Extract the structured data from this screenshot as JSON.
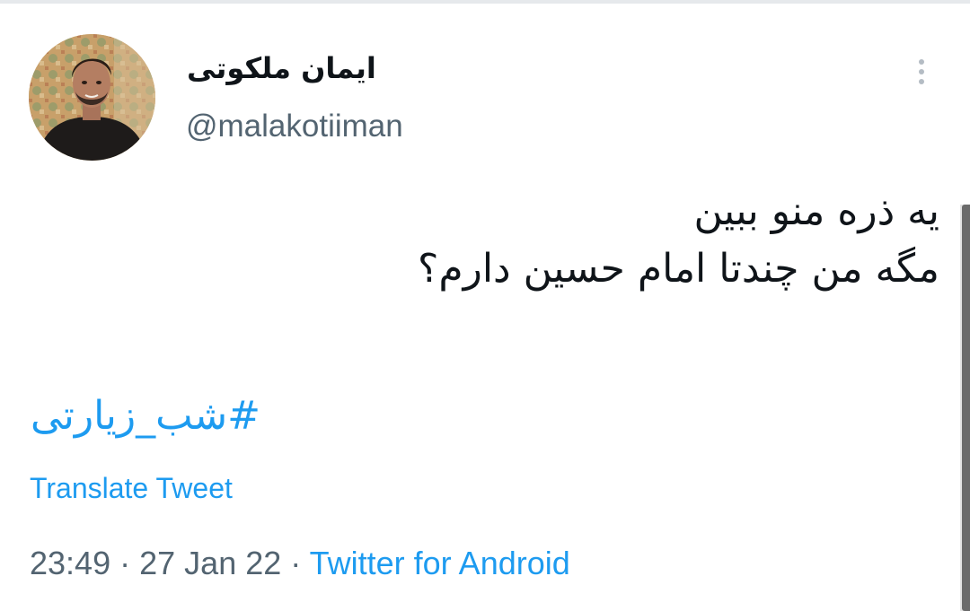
{
  "author": {
    "display_name": "ایمان ملکوتی",
    "handle": "@malakotiiman"
  },
  "tweet": {
    "lines": [
      "یه ذره منو ببین",
      "مگه من چندتا امام حسین دارم؟"
    ],
    "hashtag": "#شب_زیارتی",
    "translate_label": "Translate Tweet",
    "time": "23:49",
    "separator": "·",
    "date": "27 Jan 22",
    "source": "Twitter for Android"
  },
  "icons": {
    "more": "more-vertical-icon"
  },
  "colors": {
    "accent": "#1d9bf0",
    "text": "#0f1419",
    "secondary": "#536471"
  }
}
